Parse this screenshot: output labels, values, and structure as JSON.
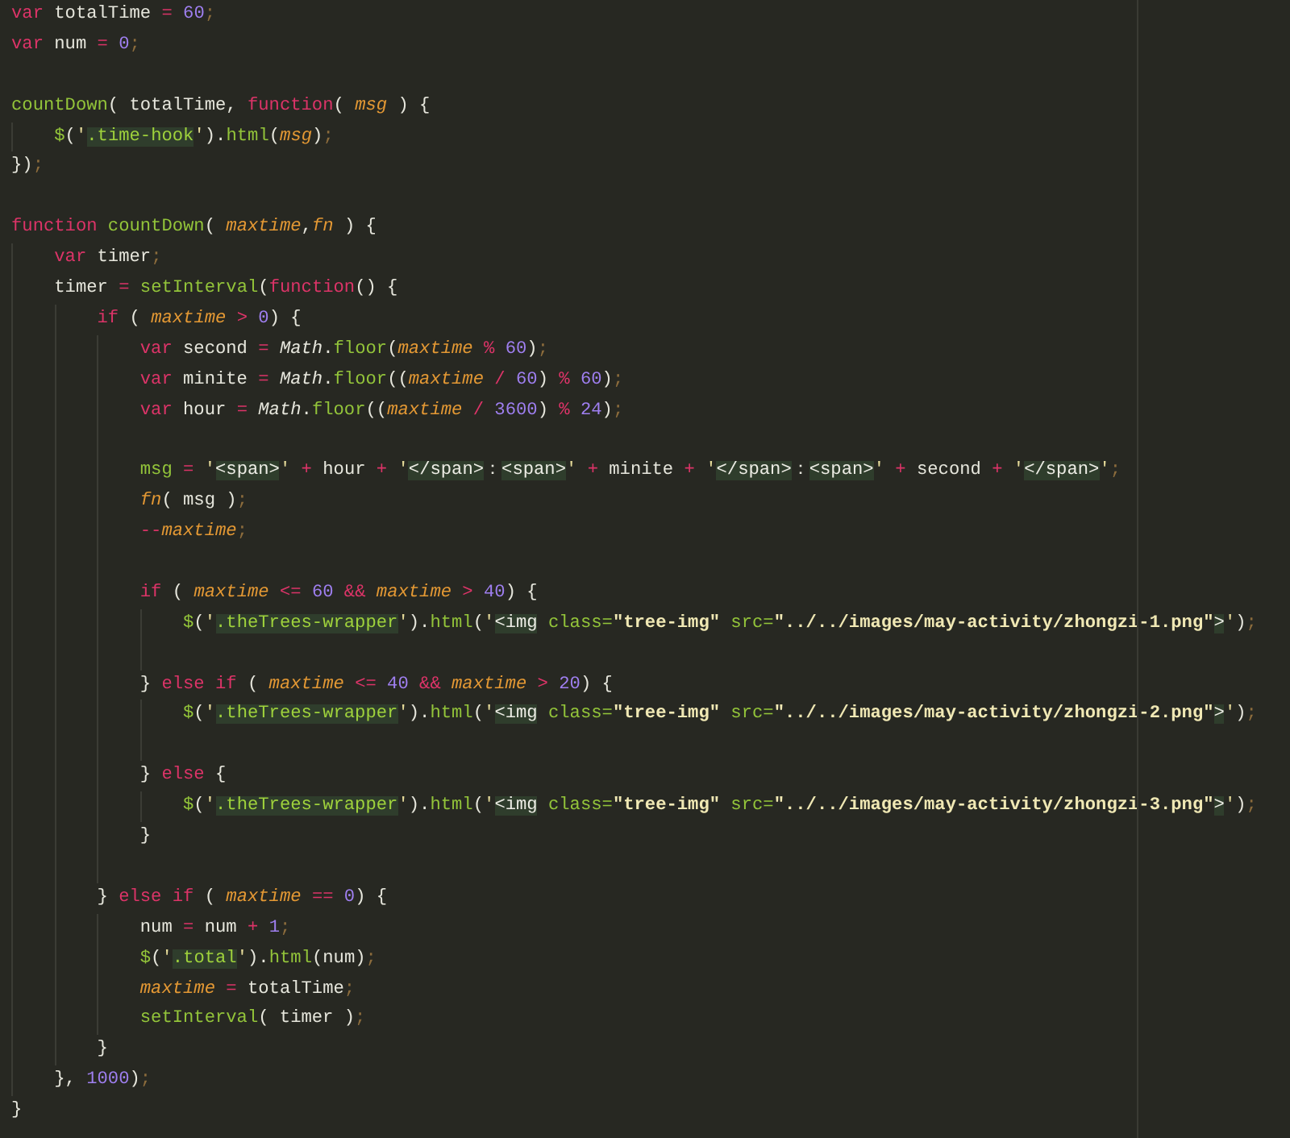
{
  "editor": {
    "lines": [
      {
        "kind": "code",
        "tokens": [
          {
            "kind": "keyword",
            "text": "var"
          },
          {
            "kind": "plain",
            "text": " totalTime"
          },
          {
            "kind": "operator",
            "text": " ="
          },
          {
            "kind": "number",
            "text": " 60"
          },
          {
            "kind": "semicolon",
            "text": ";"
          }
        ]
      },
      {
        "kind": "code",
        "tokens": [
          {
            "kind": "keyword",
            "text": "var"
          },
          {
            "kind": "plain",
            "text": " num"
          },
          {
            "kind": "operator",
            "text": " ="
          },
          {
            "kind": "number",
            "text": " 0"
          },
          {
            "kind": "semicolon",
            "text": ";"
          }
        ]
      },
      {
        "kind": "blank"
      },
      {
        "kind": "code",
        "tokens": [
          {
            "kind": "function",
            "text": "countDown"
          },
          {
            "kind": "plain",
            "text": "( totalTime, "
          },
          {
            "kind": "keyword",
            "text": "function"
          },
          {
            "kind": "plain",
            "text": "( "
          },
          {
            "kind": "param",
            "text": "msg"
          },
          {
            "kind": "plain",
            "text": " ) {"
          }
        ],
        "children": [
          {
            "kind": "code",
            "tokens": [
              {
                "kind": "function",
                "text": "$"
              },
              {
                "kind": "plain",
                "text": "("
              },
              {
                "kind": "quote",
                "text": "'"
              },
              {
                "kind": "string",
                "text": ".time-hook"
              },
              {
                "kind": "quote",
                "text": "'"
              },
              {
                "kind": "plain",
                "text": ")."
              },
              {
                "kind": "function",
                "text": "html"
              },
              {
                "kind": "plain",
                "text": "("
              },
              {
                "kind": "param",
                "text": "msg"
              },
              {
                "kind": "plain",
                "text": ")"
              },
              {
                "kind": "semicolon",
                "text": ";"
              }
            ]
          }
        ]
      },
      {
        "kind": "code",
        "tokens": [
          {
            "kind": "plain",
            "text": "})"
          },
          {
            "kind": "semicolon",
            "text": ";"
          }
        ]
      },
      {
        "kind": "blank"
      },
      {
        "kind": "code",
        "tokens": [
          {
            "kind": "keyword",
            "text": "function"
          },
          {
            "kind": "function",
            "text": " countDown"
          },
          {
            "kind": "plain",
            "text": "( "
          },
          {
            "kind": "param",
            "text": "maxtime"
          },
          {
            "kind": "plain",
            "text": ","
          },
          {
            "kind": "param",
            "text": "fn"
          },
          {
            "kind": "plain",
            "text": " ) {"
          }
        ],
        "children": [
          {
            "kind": "code",
            "tokens": [
              {
                "kind": "keyword",
                "text": "var"
              },
              {
                "kind": "plain",
                "text": " timer"
              },
              {
                "kind": "semicolon",
                "text": ";"
              }
            ]
          },
          {
            "kind": "code",
            "tokens": [
              {
                "kind": "plain",
                "text": "timer"
              },
              {
                "kind": "operator",
                "text": " ="
              },
              {
                "kind": "function",
                "text": " setInterval"
              },
              {
                "kind": "plain",
                "text": "("
              },
              {
                "kind": "keyword",
                "text": "function"
              },
              {
                "kind": "plain",
                "text": "() {"
              }
            ],
            "children": [
              {
                "kind": "code",
                "tokens": [
                  {
                    "kind": "keyword",
                    "text": "if"
                  },
                  {
                    "kind": "plain",
                    "text": " ( "
                  },
                  {
                    "kind": "param",
                    "text": "maxtime"
                  },
                  {
                    "kind": "operator",
                    "text": " >"
                  },
                  {
                    "kind": "number",
                    "text": " 0"
                  },
                  {
                    "kind": "plain",
                    "text": ") {"
                  }
                ],
                "children": [
                  {
                    "kind": "code",
                    "tokens": [
                      {
                        "kind": "keyword",
                        "text": "var"
                      },
                      {
                        "kind": "plain",
                        "text": " second"
                      },
                      {
                        "kind": "operator",
                        "text": " ="
                      },
                      {
                        "kind": "object",
                        "text": " Math"
                      },
                      {
                        "kind": "plain",
                        "text": "."
                      },
                      {
                        "kind": "function",
                        "text": "floor"
                      },
                      {
                        "kind": "plain",
                        "text": "("
                      },
                      {
                        "kind": "param",
                        "text": "maxtime"
                      },
                      {
                        "kind": "operator",
                        "text": " %"
                      },
                      {
                        "kind": "number",
                        "text": " 60"
                      },
                      {
                        "kind": "plain",
                        "text": ")"
                      },
                      {
                        "kind": "semicolon",
                        "text": ";"
                      }
                    ]
                  },
                  {
                    "kind": "code",
                    "tokens": [
                      {
                        "kind": "keyword",
                        "text": "var"
                      },
                      {
                        "kind": "plain",
                        "text": " minite"
                      },
                      {
                        "kind": "operator",
                        "text": " ="
                      },
                      {
                        "kind": "object",
                        "text": " Math"
                      },
                      {
                        "kind": "plain",
                        "text": "."
                      },
                      {
                        "kind": "function",
                        "text": "floor"
                      },
                      {
                        "kind": "plain",
                        "text": "(("
                      },
                      {
                        "kind": "param",
                        "text": "maxtime"
                      },
                      {
                        "kind": "operator",
                        "text": " /"
                      },
                      {
                        "kind": "number",
                        "text": " 60"
                      },
                      {
                        "kind": "plain",
                        "text": ")"
                      },
                      {
                        "kind": "operator",
                        "text": " %"
                      },
                      {
                        "kind": "number",
                        "text": " 60"
                      },
                      {
                        "kind": "plain",
                        "text": ")"
                      },
                      {
                        "kind": "semicolon",
                        "text": ";"
                      }
                    ]
                  },
                  {
                    "kind": "code",
                    "tokens": [
                      {
                        "kind": "keyword",
                        "text": "var"
                      },
                      {
                        "kind": "plain",
                        "text": " hour"
                      },
                      {
                        "kind": "operator",
                        "text": " ="
                      },
                      {
                        "kind": "object",
                        "text": " Math"
                      },
                      {
                        "kind": "plain",
                        "text": "."
                      },
                      {
                        "kind": "function",
                        "text": "floor"
                      },
                      {
                        "kind": "plain",
                        "text": "(("
                      },
                      {
                        "kind": "param",
                        "text": "maxtime"
                      },
                      {
                        "kind": "operator",
                        "text": " /"
                      },
                      {
                        "kind": "number",
                        "text": " 3600"
                      },
                      {
                        "kind": "plain",
                        "text": ")"
                      },
                      {
                        "kind": "operator",
                        "text": " %"
                      },
                      {
                        "kind": "number",
                        "text": " 24"
                      },
                      {
                        "kind": "plain",
                        "text": ")"
                      },
                      {
                        "kind": "semicolon",
                        "text": ";"
                      }
                    ]
                  },
                  {
                    "kind": "blank"
                  },
                  {
                    "kind": "code",
                    "tokens": [
                      {
                        "kind": "function",
                        "text": "msg"
                      },
                      {
                        "kind": "operator",
                        "text": " ="
                      },
                      {
                        "kind": "quote",
                        "text": " '"
                      },
                      {
                        "kind": "tag",
                        "text": "<span>"
                      },
                      {
                        "kind": "quote",
                        "text": "'"
                      },
                      {
                        "kind": "operator",
                        "text": " +"
                      },
                      {
                        "kind": "plain",
                        "text": " hour"
                      },
                      {
                        "kind": "operator",
                        "text": " +"
                      },
                      {
                        "kind": "quote",
                        "text": " '"
                      },
                      {
                        "kind": "tag",
                        "text": "</span>"
                      },
                      {
                        "kind": "plain",
                        "text": "："
                      },
                      {
                        "kind": "tag",
                        "text": "<span>"
                      },
                      {
                        "kind": "quote",
                        "text": "'"
                      },
                      {
                        "kind": "operator",
                        "text": " +"
                      },
                      {
                        "kind": "plain",
                        "text": " minite"
                      },
                      {
                        "kind": "operator",
                        "text": " +"
                      },
                      {
                        "kind": "quote",
                        "text": " '"
                      },
                      {
                        "kind": "tag",
                        "text": "</span>"
                      },
                      {
                        "kind": "plain",
                        "text": "："
                      },
                      {
                        "kind": "tag",
                        "text": "<span>"
                      },
                      {
                        "kind": "quote",
                        "text": "'"
                      },
                      {
                        "kind": "operator",
                        "text": " +"
                      },
                      {
                        "kind": "plain",
                        "text": " second"
                      },
                      {
                        "kind": "operator",
                        "text": " +"
                      },
                      {
                        "kind": "quote",
                        "text": " '"
                      },
                      {
                        "kind": "tag",
                        "text": "</span>"
                      },
                      {
                        "kind": "quote",
                        "text": "'"
                      },
                      {
                        "kind": "semicolon",
                        "text": ";"
                      }
                    ]
                  },
                  {
                    "kind": "code",
                    "tokens": [
                      {
                        "kind": "param",
                        "text": "fn"
                      },
                      {
                        "kind": "plain",
                        "text": "( msg )"
                      },
                      {
                        "kind": "semicolon",
                        "text": ";"
                      }
                    ]
                  },
                  {
                    "kind": "code",
                    "tokens": [
                      {
                        "kind": "operator",
                        "text": "--"
                      },
                      {
                        "kind": "param",
                        "text": "maxtime"
                      },
                      {
                        "kind": "semicolon",
                        "text": ";"
                      }
                    ]
                  },
                  {
                    "kind": "blank"
                  },
                  {
                    "kind": "code",
                    "tokens": [
                      {
                        "kind": "keyword",
                        "text": "if"
                      },
                      {
                        "kind": "plain",
                        "text": " ( "
                      },
                      {
                        "kind": "param",
                        "text": "maxtime"
                      },
                      {
                        "kind": "operator",
                        "text": " <="
                      },
                      {
                        "kind": "number",
                        "text": " 60"
                      },
                      {
                        "kind": "operator",
                        "text": " &&"
                      },
                      {
                        "kind": "param",
                        "text": " maxtime"
                      },
                      {
                        "kind": "operator",
                        "text": " >"
                      },
                      {
                        "kind": "number",
                        "text": " 40"
                      },
                      {
                        "kind": "plain",
                        "text": ") {"
                      }
                    ],
                    "children": [
                      {
                        "kind": "code",
                        "tokens": [
                          {
                            "kind": "function",
                            "text": "$"
                          },
                          {
                            "kind": "plain",
                            "text": "("
                          },
                          {
                            "kind": "quote",
                            "text": "'"
                          },
                          {
                            "kind": "string",
                            "text": ".theTrees-wrapper"
                          },
                          {
                            "kind": "quote",
                            "text": "'"
                          },
                          {
                            "kind": "plain",
                            "text": ")."
                          },
                          {
                            "kind": "function",
                            "text": "html"
                          },
                          {
                            "kind": "plain",
                            "text": "("
                          },
                          {
                            "kind": "quote",
                            "text": "'"
                          },
                          {
                            "kind": "tag",
                            "text": "<img"
                          },
                          {
                            "kind": "attr",
                            "text": " class="
                          },
                          {
                            "kind": "value",
                            "text": "\"tree-img\""
                          },
                          {
                            "kind": "attr",
                            "text": " src="
                          },
                          {
                            "kind": "value",
                            "text": "\"../../images/may-activity/zhongzi-1.png\""
                          },
                          {
                            "kind": "tag",
                            "text": ">"
                          },
                          {
                            "kind": "quote",
                            "text": "'"
                          },
                          {
                            "kind": "plain",
                            "text": ")"
                          },
                          {
                            "kind": "semicolon",
                            "text": ";"
                          }
                        ]
                      },
                      {
                        "kind": "blank"
                      }
                    ]
                  },
                  {
                    "kind": "code",
                    "tokens": [
                      {
                        "kind": "plain",
                        "text": "} "
                      },
                      {
                        "kind": "keyword",
                        "text": "else if"
                      },
                      {
                        "kind": "plain",
                        "text": " ( "
                      },
                      {
                        "kind": "param",
                        "text": "maxtime"
                      },
                      {
                        "kind": "operator",
                        "text": " <="
                      },
                      {
                        "kind": "number",
                        "text": " 40"
                      },
                      {
                        "kind": "operator",
                        "text": " &&"
                      },
                      {
                        "kind": "param",
                        "text": " maxtime"
                      },
                      {
                        "kind": "operator",
                        "text": " >"
                      },
                      {
                        "kind": "number",
                        "text": " 20"
                      },
                      {
                        "kind": "plain",
                        "text": ") {"
                      }
                    ],
                    "children": [
                      {
                        "kind": "code",
                        "tokens": [
                          {
                            "kind": "function",
                            "text": "$"
                          },
                          {
                            "kind": "plain",
                            "text": "("
                          },
                          {
                            "kind": "quote",
                            "text": "'"
                          },
                          {
                            "kind": "string",
                            "text": ".theTrees-wrapper"
                          },
                          {
                            "kind": "quote",
                            "text": "'"
                          },
                          {
                            "kind": "plain",
                            "text": ")."
                          },
                          {
                            "kind": "function",
                            "text": "html"
                          },
                          {
                            "kind": "plain",
                            "text": "("
                          },
                          {
                            "kind": "quote",
                            "text": "'"
                          },
                          {
                            "kind": "tag",
                            "text": "<img"
                          },
                          {
                            "kind": "attr",
                            "text": " class="
                          },
                          {
                            "kind": "value",
                            "text": "\"tree-img\""
                          },
                          {
                            "kind": "attr",
                            "text": " src="
                          },
                          {
                            "kind": "value",
                            "text": "\"../../images/may-activity/zhongzi-2.png\""
                          },
                          {
                            "kind": "tag",
                            "text": ">"
                          },
                          {
                            "kind": "quote",
                            "text": "'"
                          },
                          {
                            "kind": "plain",
                            "text": ")"
                          },
                          {
                            "kind": "semicolon",
                            "text": ";"
                          }
                        ]
                      },
                      {
                        "kind": "blank"
                      }
                    ]
                  },
                  {
                    "kind": "code",
                    "tokens": [
                      {
                        "kind": "plain",
                        "text": "} "
                      },
                      {
                        "kind": "keyword",
                        "text": "else"
                      },
                      {
                        "kind": "plain",
                        "text": " {"
                      }
                    ],
                    "children": [
                      {
                        "kind": "code",
                        "tokens": [
                          {
                            "kind": "function",
                            "text": "$"
                          },
                          {
                            "kind": "plain",
                            "text": "("
                          },
                          {
                            "kind": "quote",
                            "text": "'"
                          },
                          {
                            "kind": "string",
                            "text": ".theTrees-wrapper"
                          },
                          {
                            "kind": "quote",
                            "text": "'"
                          },
                          {
                            "kind": "plain",
                            "text": ")."
                          },
                          {
                            "kind": "function",
                            "text": "html"
                          },
                          {
                            "kind": "plain",
                            "text": "("
                          },
                          {
                            "kind": "quote",
                            "text": "'"
                          },
                          {
                            "kind": "tag",
                            "text": "<img"
                          },
                          {
                            "kind": "attr",
                            "text": " class="
                          },
                          {
                            "kind": "value",
                            "text": "\"tree-img\""
                          },
                          {
                            "kind": "attr",
                            "text": " src="
                          },
                          {
                            "kind": "value",
                            "text": "\"../../images/may-activity/zhongzi-3.png\""
                          },
                          {
                            "kind": "tag",
                            "text": ">"
                          },
                          {
                            "kind": "quote",
                            "text": "'"
                          },
                          {
                            "kind": "plain",
                            "text": ")"
                          },
                          {
                            "kind": "semicolon",
                            "text": ";"
                          }
                        ]
                      }
                    ]
                  },
                  {
                    "kind": "code",
                    "tokens": [
                      {
                        "kind": "plain",
                        "text": "}"
                      }
                    ]
                  },
                  {
                    "kind": "blank"
                  }
                ]
              },
              {
                "kind": "code",
                "tokens": [
                  {
                    "kind": "plain",
                    "text": "} "
                  },
                  {
                    "kind": "keyword",
                    "text": "else if"
                  },
                  {
                    "kind": "plain",
                    "text": " ( "
                  },
                  {
                    "kind": "param",
                    "text": "maxtime"
                  },
                  {
                    "kind": "operator",
                    "text": " =="
                  },
                  {
                    "kind": "number",
                    "text": " 0"
                  },
                  {
                    "kind": "plain",
                    "text": ") {"
                  }
                ],
                "children": [
                  {
                    "kind": "code",
                    "tokens": [
                      {
                        "kind": "plain",
                        "text": "num"
                      },
                      {
                        "kind": "operator",
                        "text": " ="
                      },
                      {
                        "kind": "plain",
                        "text": " num"
                      },
                      {
                        "kind": "operator",
                        "text": " +"
                      },
                      {
                        "kind": "number",
                        "text": " 1"
                      },
                      {
                        "kind": "semicolon",
                        "text": ";"
                      }
                    ]
                  },
                  {
                    "kind": "code",
                    "tokens": [
                      {
                        "kind": "function",
                        "text": "$"
                      },
                      {
                        "kind": "plain",
                        "text": "("
                      },
                      {
                        "kind": "quote",
                        "text": "'"
                      },
                      {
                        "kind": "string",
                        "text": ".total"
                      },
                      {
                        "kind": "quote",
                        "text": "'"
                      },
                      {
                        "kind": "plain",
                        "text": ")."
                      },
                      {
                        "kind": "function",
                        "text": "html"
                      },
                      {
                        "kind": "plain",
                        "text": "(num)"
                      },
                      {
                        "kind": "semicolon",
                        "text": ";"
                      }
                    ]
                  },
                  {
                    "kind": "code",
                    "tokens": [
                      {
                        "kind": "param",
                        "text": "maxtime"
                      },
                      {
                        "kind": "operator",
                        "text": " ="
                      },
                      {
                        "kind": "plain",
                        "text": " totalTime"
                      },
                      {
                        "kind": "semicolon",
                        "text": ";"
                      }
                    ]
                  },
                  {
                    "kind": "code",
                    "tokens": [
                      {
                        "kind": "function",
                        "text": "setInterval"
                      },
                      {
                        "kind": "plain",
                        "text": "( timer )"
                      },
                      {
                        "kind": "semicolon",
                        "text": ";"
                      }
                    ]
                  }
                ]
              },
              {
                "kind": "code",
                "tokens": [
                  {
                    "kind": "plain",
                    "text": "}"
                  }
                ]
              }
            ]
          },
          {
            "kind": "code",
            "tokens": [
              {
                "kind": "plain",
                "text": "}, "
              },
              {
                "kind": "number",
                "text": "1000"
              },
              {
                "kind": "plain",
                "text": ")"
              },
              {
                "kind": "semicolon",
                "text": ";"
              }
            ]
          }
        ]
      },
      {
        "kind": "code",
        "tokens": [
          {
            "kind": "plain",
            "text": "}"
          }
        ]
      }
    ]
  }
}
